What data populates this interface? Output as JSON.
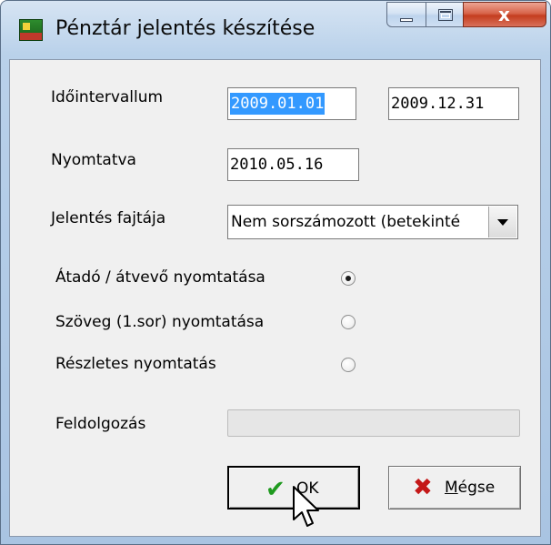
{
  "window": {
    "title": "Pénztár jelentés készítése",
    "buttons": {
      "minimize": "minimize",
      "maximize": "maximize",
      "close": "x"
    }
  },
  "form": {
    "interval": {
      "label": "Időintervallum",
      "from": "2009.01.01",
      "to": "2009.12.31"
    },
    "printed": {
      "label": "Nyomtatva",
      "value": "2010.05.16"
    },
    "report_type": {
      "label": "Jelentés fajtája",
      "value": "Nem sorszámozott (betekinté"
    },
    "options": [
      {
        "label": "Átadó / átvevő nyomtatása",
        "checked": true
      },
      {
        "label": "Szöveg (1.sor) nyomtatása",
        "checked": false
      },
      {
        "label": "Részletes nyomtatás",
        "checked": false
      }
    ],
    "processing": {
      "label": "Feldolgozás",
      "progress": 0
    }
  },
  "actions": {
    "ok": {
      "label": "OK",
      "icon": "checkmark-icon",
      "accent": "#1f9a1f"
    },
    "cancel": {
      "label_mnemonic": "M",
      "label_rest": "égse",
      "icon": "x-mark-icon",
      "accent": "#c41818"
    }
  }
}
